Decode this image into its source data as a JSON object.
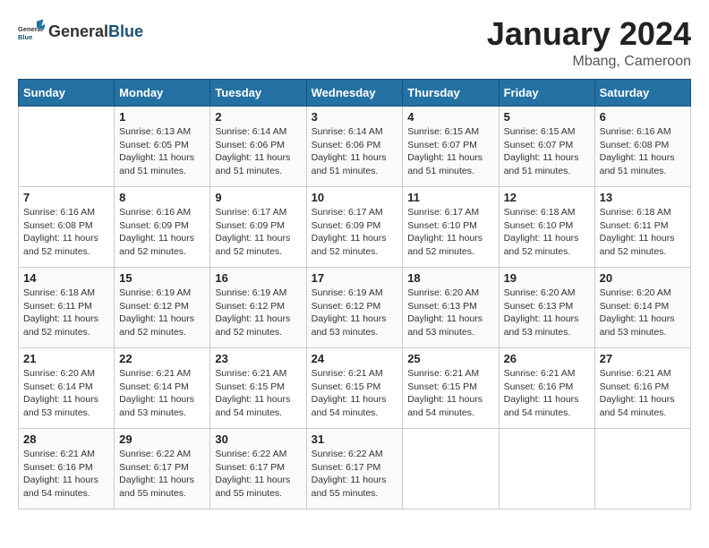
{
  "header": {
    "logo": {
      "general": "General",
      "blue": "Blue"
    },
    "title": "January 2024",
    "location": "Mbang, Cameroon"
  },
  "calendar": {
    "days_of_week": [
      "Sunday",
      "Monday",
      "Tuesday",
      "Wednesday",
      "Thursday",
      "Friday",
      "Saturday"
    ],
    "weeks": [
      [
        {
          "day": "",
          "info": ""
        },
        {
          "day": "1",
          "info": "Sunrise: 6:13 AM\nSunset: 6:05 PM\nDaylight: 11 hours\nand 51 minutes."
        },
        {
          "day": "2",
          "info": "Sunrise: 6:14 AM\nSunset: 6:06 PM\nDaylight: 11 hours\nand 51 minutes."
        },
        {
          "day": "3",
          "info": "Sunrise: 6:14 AM\nSunset: 6:06 PM\nDaylight: 11 hours\nand 51 minutes."
        },
        {
          "day": "4",
          "info": "Sunrise: 6:15 AM\nSunset: 6:07 PM\nDaylight: 11 hours\nand 51 minutes."
        },
        {
          "day": "5",
          "info": "Sunrise: 6:15 AM\nSunset: 6:07 PM\nDaylight: 11 hours\nand 51 minutes."
        },
        {
          "day": "6",
          "info": "Sunrise: 6:16 AM\nSunset: 6:08 PM\nDaylight: 11 hours\nand 51 minutes."
        }
      ],
      [
        {
          "day": "7",
          "info": "Sunrise: 6:16 AM\nSunset: 6:08 PM\nDaylight: 11 hours\nand 52 minutes."
        },
        {
          "day": "8",
          "info": "Sunrise: 6:16 AM\nSunset: 6:09 PM\nDaylight: 11 hours\nand 52 minutes."
        },
        {
          "day": "9",
          "info": "Sunrise: 6:17 AM\nSunset: 6:09 PM\nDaylight: 11 hours\nand 52 minutes."
        },
        {
          "day": "10",
          "info": "Sunrise: 6:17 AM\nSunset: 6:09 PM\nDaylight: 11 hours\nand 52 minutes."
        },
        {
          "day": "11",
          "info": "Sunrise: 6:17 AM\nSunset: 6:10 PM\nDaylight: 11 hours\nand 52 minutes."
        },
        {
          "day": "12",
          "info": "Sunrise: 6:18 AM\nSunset: 6:10 PM\nDaylight: 11 hours\nand 52 minutes."
        },
        {
          "day": "13",
          "info": "Sunrise: 6:18 AM\nSunset: 6:11 PM\nDaylight: 11 hours\nand 52 minutes."
        }
      ],
      [
        {
          "day": "14",
          "info": "Sunrise: 6:18 AM\nSunset: 6:11 PM\nDaylight: 11 hours\nand 52 minutes."
        },
        {
          "day": "15",
          "info": "Sunrise: 6:19 AM\nSunset: 6:12 PM\nDaylight: 11 hours\nand 52 minutes."
        },
        {
          "day": "16",
          "info": "Sunrise: 6:19 AM\nSunset: 6:12 PM\nDaylight: 11 hours\nand 52 minutes."
        },
        {
          "day": "17",
          "info": "Sunrise: 6:19 AM\nSunset: 6:12 PM\nDaylight: 11 hours\nand 53 minutes."
        },
        {
          "day": "18",
          "info": "Sunrise: 6:20 AM\nSunset: 6:13 PM\nDaylight: 11 hours\nand 53 minutes."
        },
        {
          "day": "19",
          "info": "Sunrise: 6:20 AM\nSunset: 6:13 PM\nDaylight: 11 hours\nand 53 minutes."
        },
        {
          "day": "20",
          "info": "Sunrise: 6:20 AM\nSunset: 6:14 PM\nDaylight: 11 hours\nand 53 minutes."
        }
      ],
      [
        {
          "day": "21",
          "info": "Sunrise: 6:20 AM\nSunset: 6:14 PM\nDaylight: 11 hours\nand 53 minutes."
        },
        {
          "day": "22",
          "info": "Sunrise: 6:21 AM\nSunset: 6:14 PM\nDaylight: 11 hours\nand 53 minutes."
        },
        {
          "day": "23",
          "info": "Sunrise: 6:21 AM\nSunset: 6:15 PM\nDaylight: 11 hours\nand 54 minutes."
        },
        {
          "day": "24",
          "info": "Sunrise: 6:21 AM\nSunset: 6:15 PM\nDaylight: 11 hours\nand 54 minutes."
        },
        {
          "day": "25",
          "info": "Sunrise: 6:21 AM\nSunset: 6:15 PM\nDaylight: 11 hours\nand 54 minutes."
        },
        {
          "day": "26",
          "info": "Sunrise: 6:21 AM\nSunset: 6:16 PM\nDaylight: 11 hours\nand 54 minutes."
        },
        {
          "day": "27",
          "info": "Sunrise: 6:21 AM\nSunset: 6:16 PM\nDaylight: 11 hours\nand 54 minutes."
        }
      ],
      [
        {
          "day": "28",
          "info": "Sunrise: 6:21 AM\nSunset: 6:16 PM\nDaylight: 11 hours\nand 54 minutes."
        },
        {
          "day": "29",
          "info": "Sunrise: 6:22 AM\nSunset: 6:17 PM\nDaylight: 11 hours\nand 55 minutes."
        },
        {
          "day": "30",
          "info": "Sunrise: 6:22 AM\nSunset: 6:17 PM\nDaylight: 11 hours\nand 55 minutes."
        },
        {
          "day": "31",
          "info": "Sunrise: 6:22 AM\nSunset: 6:17 PM\nDaylight: 11 hours\nand 55 minutes."
        },
        {
          "day": "",
          "info": ""
        },
        {
          "day": "",
          "info": ""
        },
        {
          "day": "",
          "info": ""
        }
      ]
    ]
  }
}
